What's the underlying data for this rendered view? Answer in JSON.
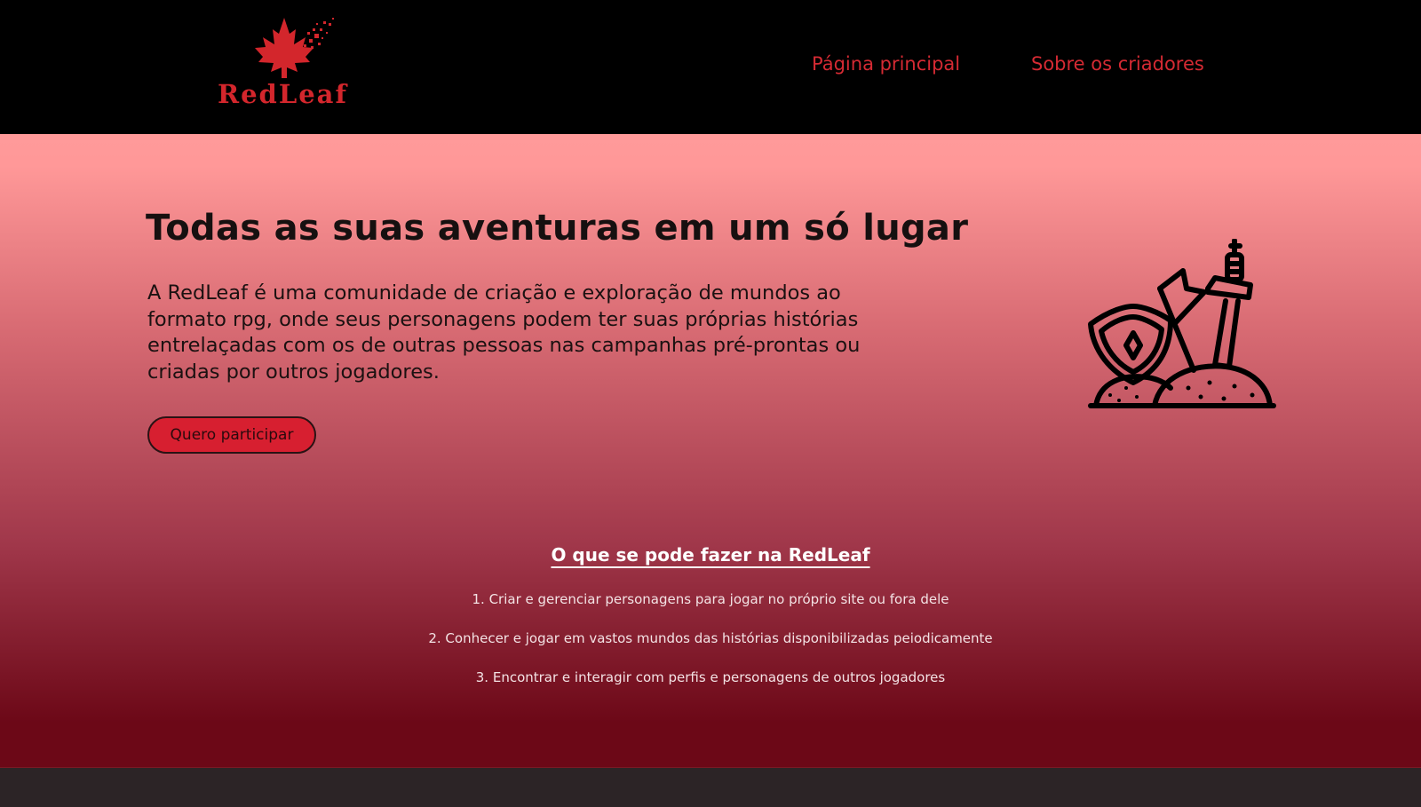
{
  "header": {
    "logo_text": "RedLeaf",
    "nav": [
      {
        "label": "Página principal"
      },
      {
        "label": "Sobre os criadores"
      }
    ]
  },
  "hero": {
    "title": "Todas as suas aventuras em um só lugar",
    "description": "A RedLeaf é uma comunidade de criação e exploração de mundos ao formato rpg, onde seus personagens podem ter suas próprias histórias entrelaçadas com os de outras pessoas nas campanhas pré-prontas ou criadas por outros jogadores.",
    "cta_label": "Quero participar",
    "illustration_icon": "shield-sword-flag-icon"
  },
  "features": {
    "title": "O que se pode fazer na RedLeaf",
    "items": [
      "1. Criar e gerenciar personagens para jogar no próprio site ou fora dele",
      "2. Conhecer e jogar em vastos mundos das histórias disponibilizadas peiodicamente",
      "3. Encontrar e interagir com perfis e personagens de outros jogadores"
    ]
  },
  "colors": {
    "brand_red": "#d3262c",
    "header_bg": "#000000",
    "gradient_top": "#ff9a9a",
    "gradient_bottom": "#6c0817",
    "footer_bg": "#2c2426"
  }
}
